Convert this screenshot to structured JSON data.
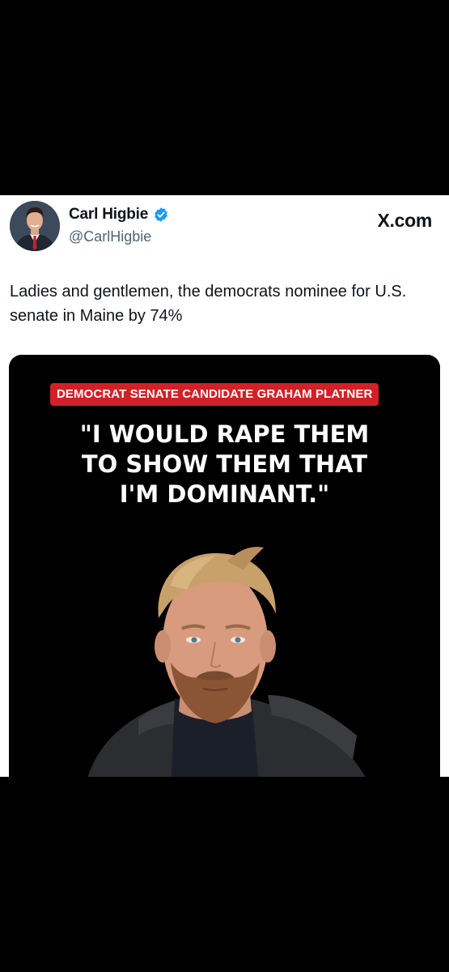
{
  "tweet": {
    "author_name": "Carl Higbie",
    "author_handle": "@CarlHigbie",
    "source_label": "X.com",
    "text": "Ladies and gentlemen, the democrats nominee for U.S. senate in Maine by 74%",
    "verified": true
  },
  "media": {
    "banner_text": "DEMOCRAT SENATE CANDIDATE GRAHAM PLATNER",
    "headline_line1": "\"I WOULD RAPE THEM",
    "headline_line2": "TO SHOW THEM THAT",
    "headline_line3": "I'M DOMINANT.\"",
    "banner_color": "#d32027"
  },
  "colors": {
    "verified_badge": "#1d9bf0",
    "card_background": "#ffffff",
    "page_background": "#000000"
  }
}
